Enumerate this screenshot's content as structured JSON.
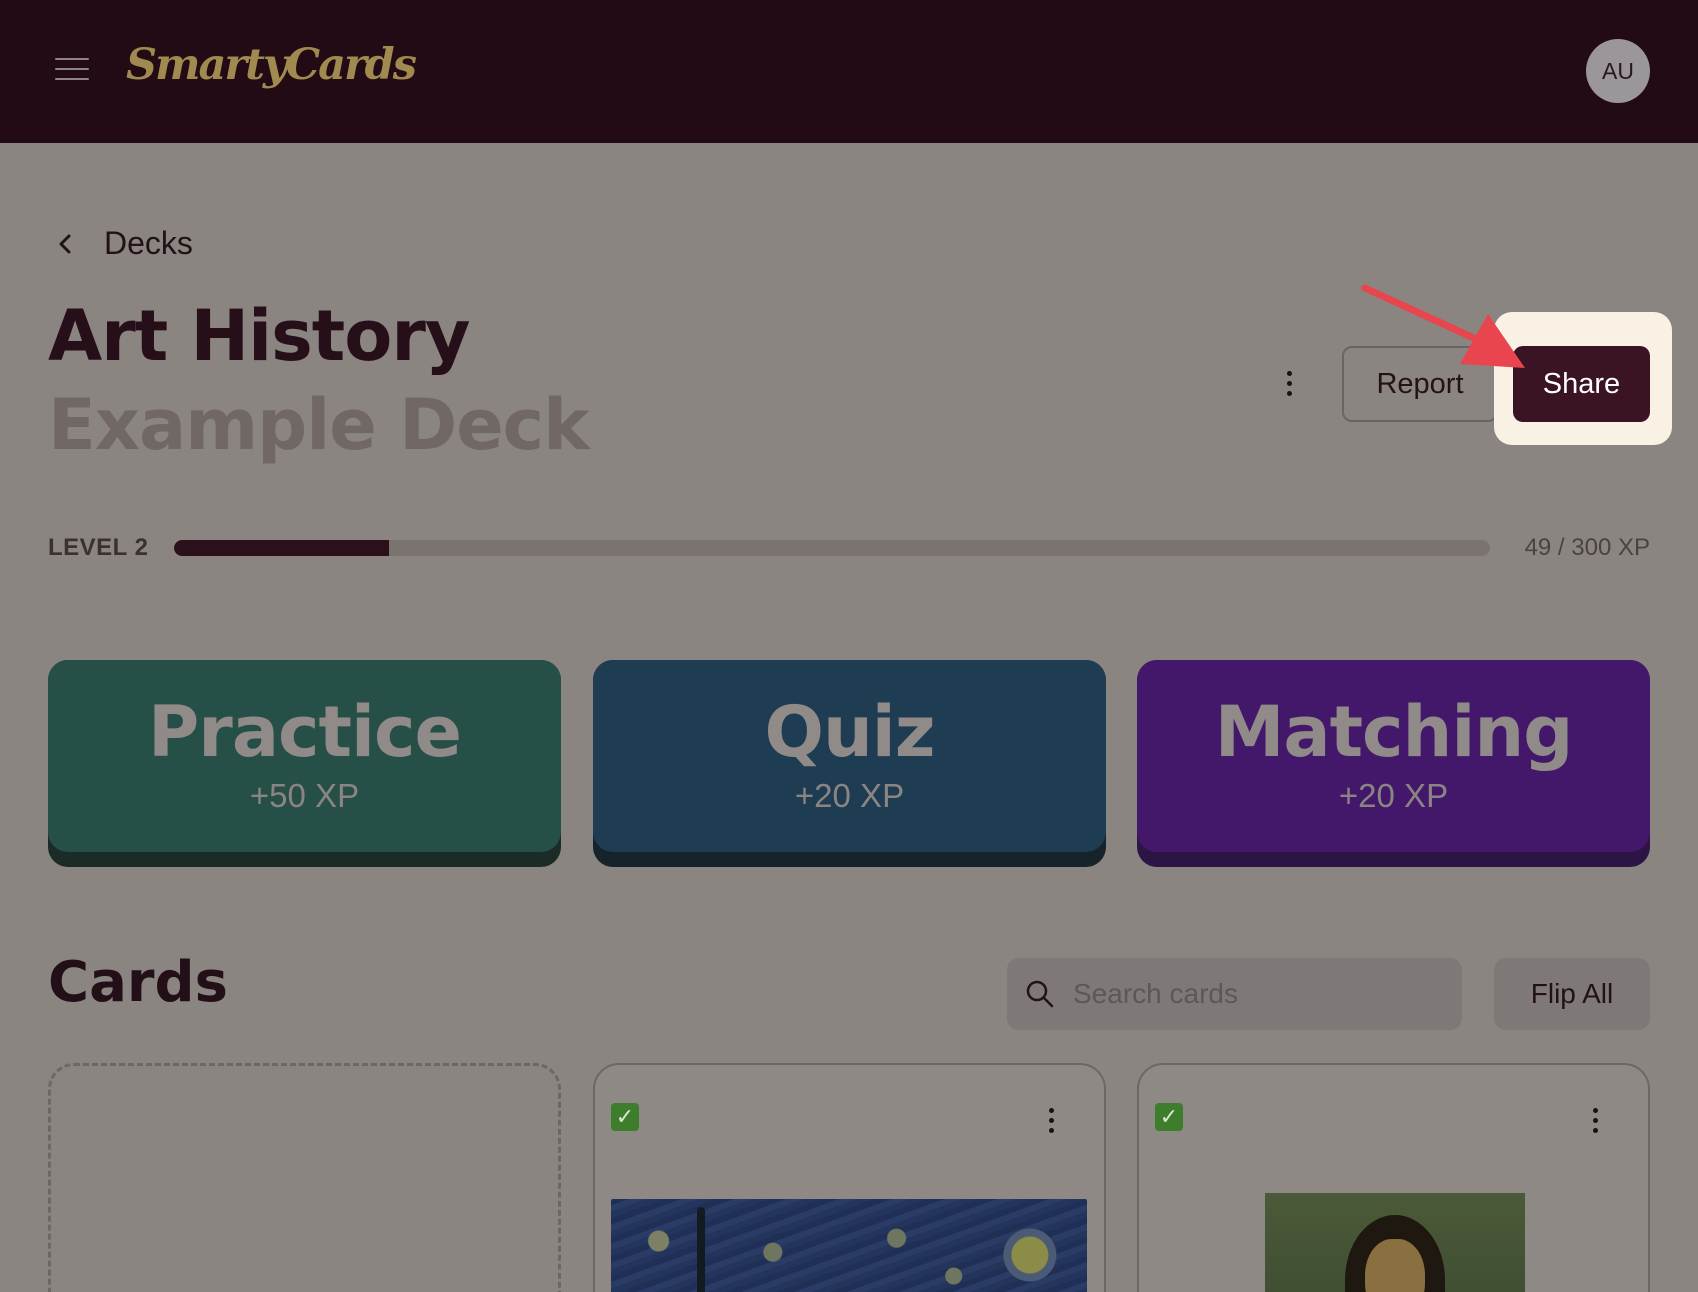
{
  "header": {
    "logo_text": "SmartyCards",
    "avatar_initials": "AU",
    "menu_icon": "hamburger-menu-icon"
  },
  "breadcrumb": {
    "label": "Decks",
    "icon": "chevron-left-icon"
  },
  "deck": {
    "title": "Art History",
    "subtitle": "Example Deck"
  },
  "actions": {
    "more_icon": "vertical-dots-icon",
    "report_label": "Report",
    "share_label": "Share",
    "highlight_color": "#f8f1e4",
    "annotation_arrow_color": "#e8454f"
  },
  "level": {
    "label": "LEVEL 2",
    "xp_text": "49 / 300 XP",
    "progress_fraction": 0.163
  },
  "modes": [
    {
      "title": "Practice",
      "xp": "+50 XP",
      "color": "#254f47"
    },
    {
      "title": "Quiz",
      "xp": "+20 XP",
      "color": "#1e3c52"
    },
    {
      "title": "Matching",
      "xp": "+20 XP",
      "color": "#43186b"
    }
  ],
  "cards_section": {
    "heading": "Cards",
    "search_placeholder": "Search cards",
    "flip_all_label": "Flip All",
    "cards": [
      {
        "checked": true,
        "image": "starry-night-painting"
      },
      {
        "checked": true,
        "image": "mona-lisa-painting"
      }
    ]
  }
}
